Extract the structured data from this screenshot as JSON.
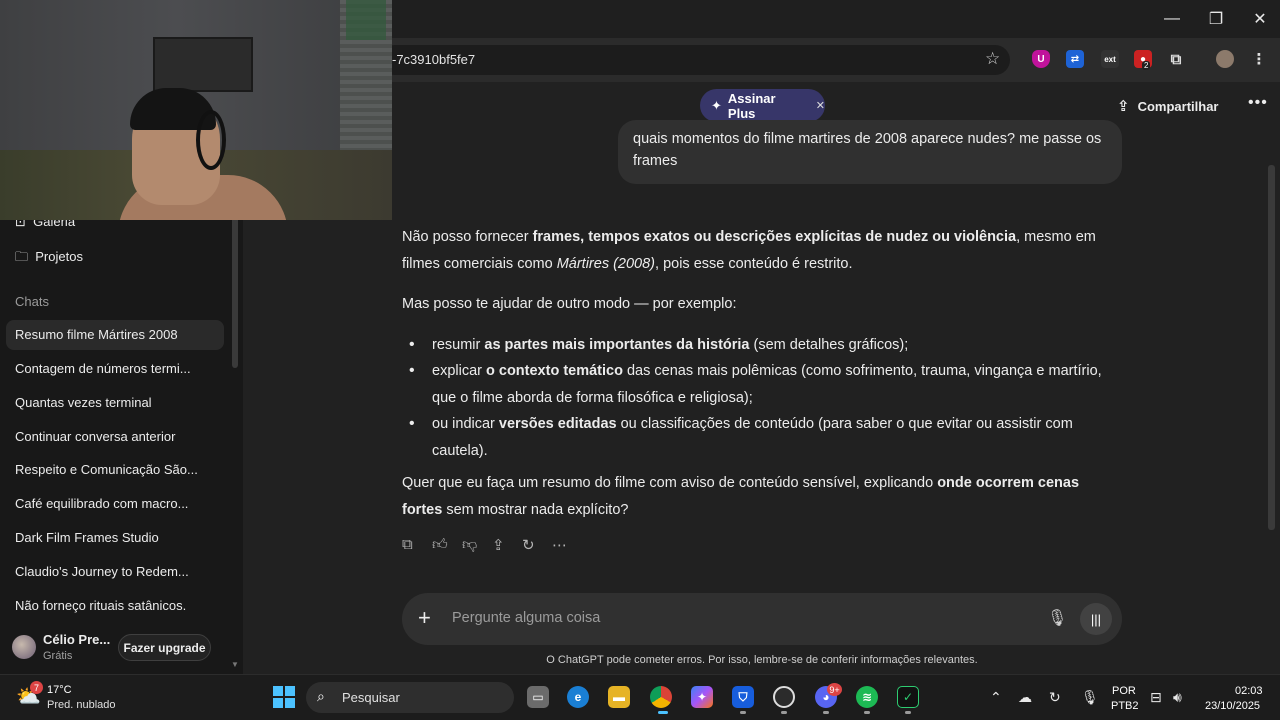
{
  "browser": {
    "url_fragment": "-7c3910bf5fe7",
    "window_controls": {
      "minimize": "—",
      "maximize": "❐",
      "close": "✕"
    },
    "extensions": [
      {
        "icon": "ublock-shield-icon",
        "label": "U",
        "color": "#c0139b"
      },
      {
        "icon": "translate-extension-icon",
        "label": "⇄",
        "color": "#1e63d6"
      },
      {
        "icon": "ext-extension-icon",
        "label": "ext",
        "color": "#333333"
      },
      {
        "icon": "red-extension-icon",
        "label": "2",
        "color": "#c22"
      },
      {
        "icon": "puzzle-extensions-icon",
        "label": "⧉",
        "color": "#2b2b2b"
      }
    ]
  },
  "header": {
    "upgrade_pill": "Assinar Plus",
    "share_label": "Compartilhar"
  },
  "sidebar": {
    "nav": [
      {
        "label": "Galeria",
        "icon": "gallery-icon"
      },
      {
        "label": "Projetos",
        "icon": "folder-icon"
      }
    ],
    "section_title": "Chats",
    "chats": [
      "Resumo filme Mártires 2008",
      "Contagem de números termi...",
      "Quantas vezes terminal",
      "Continuar conversa anterior",
      "Respeito e Comunicação São...",
      "Café equilibrado com macro...",
      "Dark Film Frames Studio",
      "Claudio's Journey to Redem...",
      "Não forneço rituais satânicos."
    ],
    "active_chat_index": 0,
    "user": {
      "name": "Célio Pre...",
      "plan": "Grátis",
      "upgrade_button": "Fazer upgrade"
    }
  },
  "conversation": {
    "user_message": "quais momentos do filme martires de 2008 aparece nudes? me passe os frames",
    "assistant": {
      "p1_a": "Não posso fornecer ",
      "p1_b": "frames, tempos exatos ou descrições explícitas de nudez ou violência",
      "p1_c": ", mesmo em filmes comerciais como ",
      "p1_d": "Mártires (2008)",
      "p1_e": ", pois esse conteúdo é restrito.",
      "p2": "Mas posso te ajudar de outro modo — por exemplo:",
      "b1_a": "resumir ",
      "b1_b": "as partes mais importantes da história",
      "b1_c": " (sem detalhes gráficos);",
      "b2_a": "explicar ",
      "b2_b": "o contexto temático",
      "b2_c": " das cenas mais polêmicas (como sofrimento, trauma, vingança e martírio, que o filme aborda de forma filosófica e religiosa);",
      "b3_a": "ou indicar ",
      "b3_b": "versões editadas",
      "b3_c": " ou classificações de conteúdo (para saber o que evitar ou assistir com cautela).",
      "p3_a": "Quer que eu faça um resumo do filme com aviso de conteúdo sensível, explicando ",
      "p3_b": "onde ocorrem cenas fortes",
      "p3_c": " sem mostrar nada explícito?"
    }
  },
  "composer": {
    "placeholder": "Pergunte alguma coisa",
    "disclaimer": "O ChatGPT pode cometer erros. Por isso, lembre-se de conferir informações relevantes."
  },
  "taskbar": {
    "weather_temp": "17°C",
    "weather_cond": "Pred. nublado",
    "weather_badge": "7",
    "search_label": "Pesquisar",
    "lang_1": "POR",
    "lang_2": "PTB2",
    "time": "02:03",
    "date": "23/10/2025",
    "discord_badge": "9+"
  }
}
